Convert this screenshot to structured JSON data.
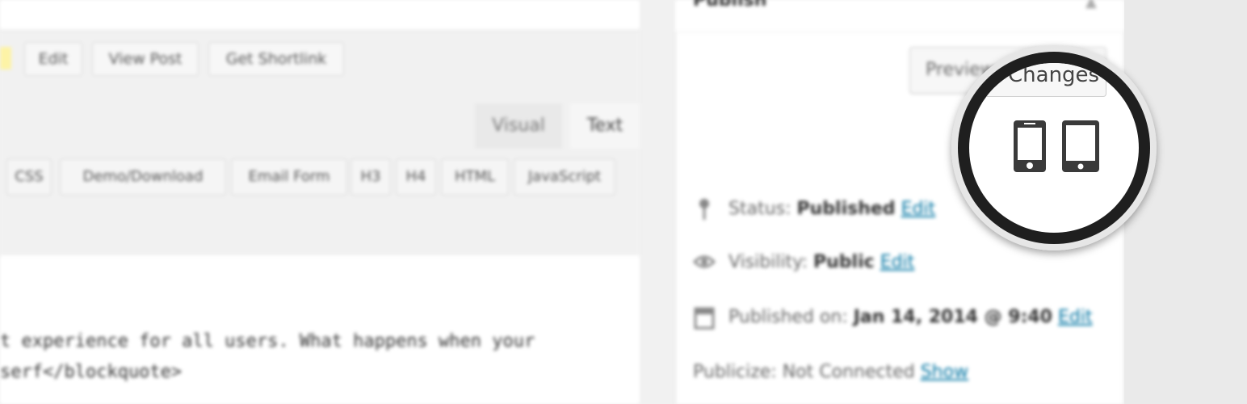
{
  "permalink_buttons": {
    "edit": "Edit",
    "view_post": "View Post",
    "get_shortlink": "Get Shortlink"
  },
  "editor_tabs": {
    "visual": "Visual",
    "text": "Text"
  },
  "quicktags": [
    "CSS",
    "Demo/Download",
    "Email Form",
    "H3",
    "H4",
    "HTML",
    "JavaScript"
  ],
  "content_lines": [
    "t experience for all users. What happens when your",
    "serf</blockquote>"
  ],
  "publish_box": {
    "title": "Publish",
    "preview_button": "Preview Changes",
    "status_label": "Status:",
    "status_value": "Published",
    "visibility_label": "Visibility:",
    "visibility_value": "Public",
    "published_label": "Published on:",
    "published_value": "Jan 14, 2014 @ 9:40",
    "edit_link": "Edit",
    "publicize_text": "Publicize: Not Connected",
    "show_link": "Show"
  },
  "magnifier": {
    "visible_text": "Changes",
    "icons": [
      "smartphone-icon",
      "tablet-icon"
    ]
  },
  "colors": {
    "link": "#0074a2",
    "icon_dark": "#3a3a3a"
  }
}
